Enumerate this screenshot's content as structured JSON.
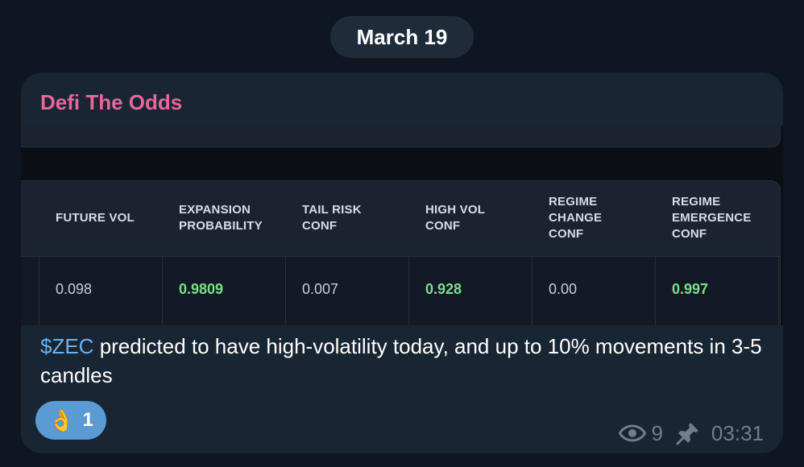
{
  "date_pill": "March 19",
  "message": {
    "sender": "Defi The Odds",
    "text_cashtag": "$ZEC",
    "text_body": " predicted to have high-volatility today, and up to 10% movements in 3-5 candles",
    "reaction": {
      "emoji": "👌",
      "count": "1"
    },
    "views": "9",
    "time": "03:31",
    "icons": {
      "views": "eye-icon",
      "pinned": "pin-icon"
    }
  },
  "table": {
    "headers": [
      [
        "FUTURE VOL"
      ],
      [
        "EXPANSION",
        "PROBABILITY"
      ],
      [
        "TAIL RISK",
        "CONF"
      ],
      [
        "HIGH VOL",
        "CONF"
      ],
      [
        "REGIME",
        "CHANGE",
        "CONF"
      ],
      [
        "REGIME",
        "EMERGENCE",
        "CONF"
      ]
    ],
    "row": [
      {
        "value": "0.098",
        "highlight": false
      },
      {
        "value": "0.9809",
        "highlight": true
      },
      {
        "value": "0.007",
        "highlight": false
      },
      {
        "value": "0.928",
        "highlight": true
      },
      {
        "value": "0.00",
        "highlight": false
      },
      {
        "value": "0.997",
        "highlight": true
      }
    ]
  },
  "colors": {
    "sender": "#e8679a",
    "cashtag": "#6ab2f2",
    "highlight_value": "#7fdc8e",
    "reaction_bg": "#5a9bd4"
  }
}
